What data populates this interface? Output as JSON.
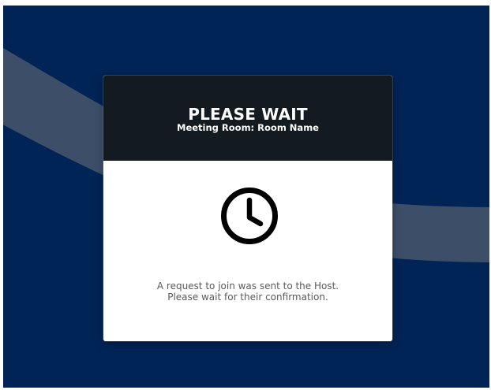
{
  "dialog": {
    "title": "PLEASE WAIT",
    "subtitle": "Meeting Room: Room Name",
    "icon": "clock-icon",
    "message_line1": "A request to join was sent to the Host.",
    "message_line2": "Please wait for their confirmation."
  },
  "colors": {
    "background": "#012456",
    "swoosh": "#3d4f68",
    "header": "#131b21",
    "body": "#ffffff",
    "message_text": "#5a5a5a"
  }
}
